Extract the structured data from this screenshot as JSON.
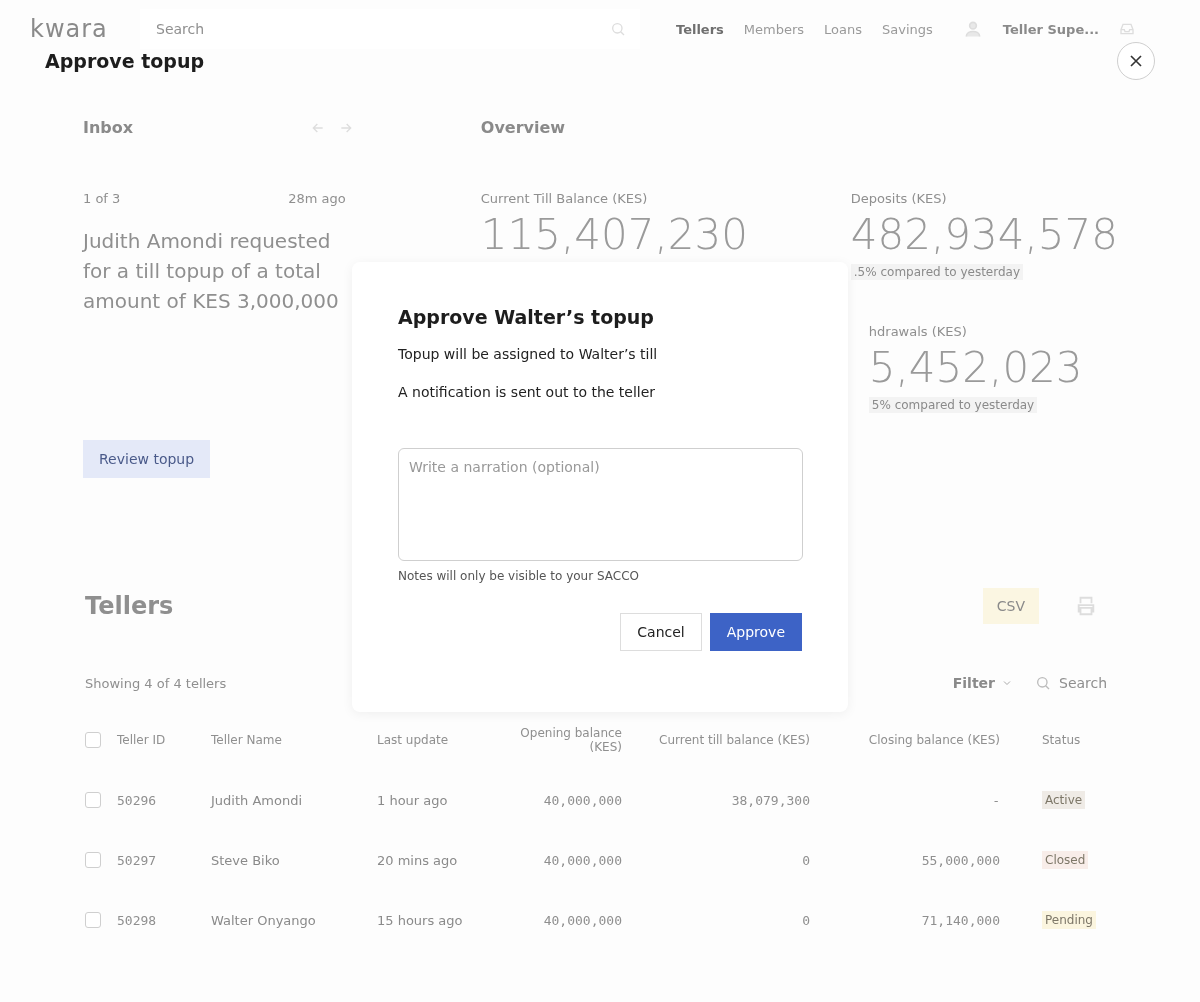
{
  "header": {
    "logo": "kwara",
    "search": {
      "placeholder": "Search"
    },
    "nav": [
      {
        "label": "Tellers",
        "selected": true
      },
      {
        "label": "Members",
        "selected": false
      },
      {
        "label": "Loans",
        "selected": false
      },
      {
        "label": "Savings",
        "selected": false
      }
    ],
    "user": "Teller Supe..."
  },
  "page_title": "Approve topup",
  "inbox": {
    "title": "Inbox",
    "counter": "1 of 3",
    "time": "28m ago",
    "message": "Judith Amondi requested for a till topup of a total amount of KES 3,000,000",
    "button": "Review topup"
  },
  "overview": {
    "title": "Overview",
    "stats": [
      {
        "label": "Current Till Balance (KES)",
        "value": "115,407,230"
      },
      {
        "label": "Deposits (KES)",
        "value": "482,934,578",
        "note": ".5% compared to yesterday"
      },
      {
        "label": "hdrawals (KES)",
        "value": "5,452,023",
        "note": "5% compared to yesterday"
      }
    ]
  },
  "tellers": {
    "title": "Tellers",
    "csv": "CSV",
    "showing": "Showing 4 of 4 tellers",
    "filter": "Filter",
    "search": {
      "placeholder": "Search"
    },
    "select_all": {
      "checked": false
    },
    "columns": [
      "Teller ID",
      "Teller Name",
      "Last update",
      "Opening balance (KES)",
      "Current till balance (KES)",
      "Closing balance (KES)",
      "Status"
    ],
    "rows": [
      {
        "checked": false,
        "cells": [
          "50296",
          "Judith Amondi",
          "1 hour ago",
          "40,000,000",
          "38,079,300",
          "-"
        ],
        "status": {
          "label": "Active",
          "color": "#efebe6"
        }
      },
      {
        "checked": false,
        "cells": [
          "50297",
          "Steve Biko",
          "20 mins ago",
          "40,000,000",
          "0",
          "55,000,000"
        ],
        "status": {
          "label": "Closed",
          "color": "#f8ede9"
        }
      },
      {
        "checked": false,
        "cells": [
          "50298",
          "Walter Onyango",
          "15 hours ago",
          "40,000,000",
          "0",
          "71,140,000"
        ],
        "status": {
          "label": "Pending",
          "color": "#fbf5df"
        }
      }
    ]
  },
  "dialog": {
    "title": "Approve Walter’s topup",
    "lines": [
      "Topup will be assigned to Walter’s till",
      "A notification is sent out to the teller"
    ],
    "narration": {
      "placeholder": "Write a narration (optional)"
    },
    "hint": "Notes will only be visible to your SACCO",
    "buttons": [
      {
        "kind": "secondary",
        "label": "Cancel"
      },
      {
        "kind": "primary",
        "label": "Approve"
      }
    ]
  }
}
